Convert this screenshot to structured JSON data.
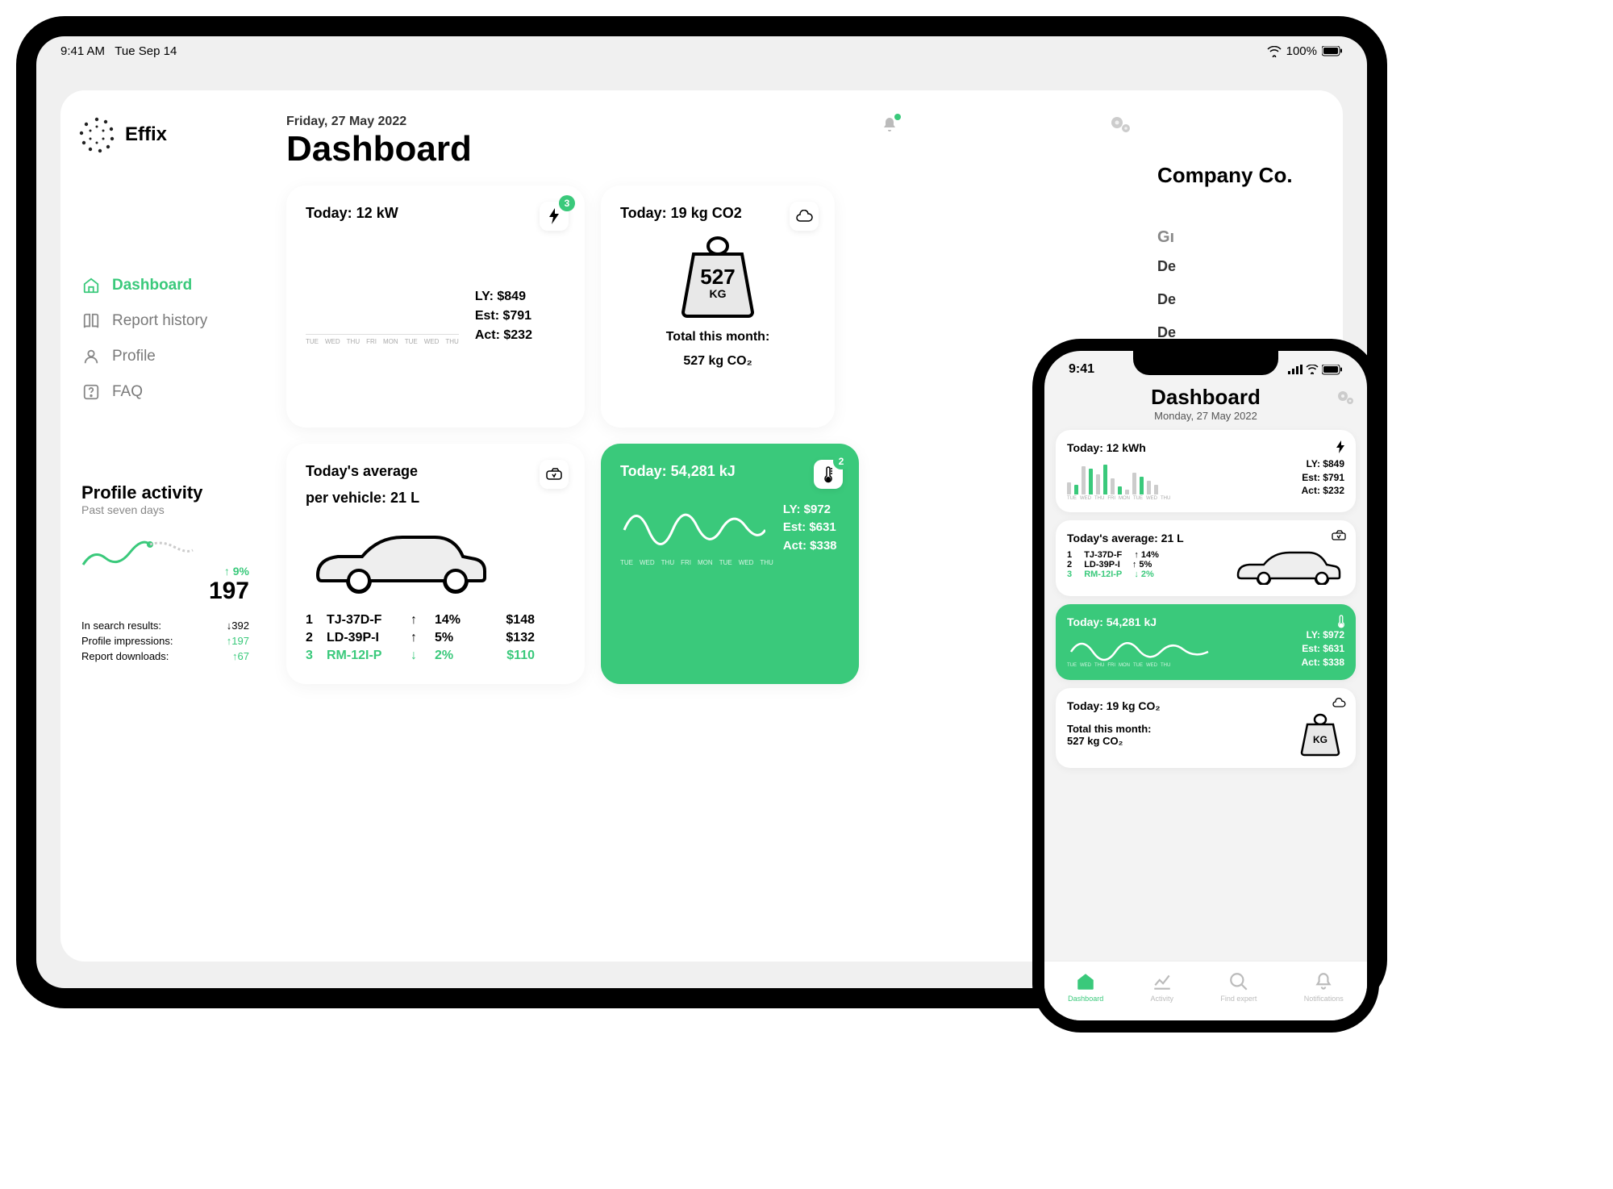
{
  "ipad_status": {
    "time": "9:41 AM",
    "date": "Tue Sep 14",
    "battery": "100%"
  },
  "iphone_status": {
    "time": "9:41"
  },
  "logo": {
    "text": "Effix"
  },
  "nav": {
    "dashboard": "Dashboard",
    "report_history": "Report history",
    "profile": "Profile",
    "faq": "FAQ"
  },
  "profile_activity": {
    "title": "Profile activity",
    "subtitle": "Past seven days",
    "delta": "↑ 9%",
    "value": "197",
    "rows": [
      {
        "label": "In search results:",
        "dir": "neg",
        "val": "392"
      },
      {
        "label": "Profile impressions:",
        "dir": "pos",
        "val": "197"
      },
      {
        "label": "Report downloads:",
        "dir": "pos",
        "val": "67"
      }
    ]
  },
  "header": {
    "date": "Friday, 27 May 2022",
    "title": "Dashboard"
  },
  "company": "Company Co.",
  "right": {
    "group": "Gı",
    "items": [
      "De",
      "De",
      "De"
    ]
  },
  "kw_card": {
    "title": "Today: 12 kW",
    "badge": "3",
    "ly": "LY: $849",
    "est": "Est: $791",
    "act": "Act: $232",
    "labels": [
      "TUE",
      "WED",
      "THU",
      "FRI",
      "MON",
      "TUE",
      "WED",
      "THU"
    ]
  },
  "co2_card": {
    "title": "Today: 19 kg CO2",
    "big": "527",
    "unit": "KG",
    "total1": "Total this month:",
    "total2": "527 kg CO₂"
  },
  "vehicle_card": {
    "title1": "Today's average",
    "title2": "per vehicle: 21 L",
    "rows": [
      {
        "idx": "1",
        "code": "TJ-37D-F",
        "arrow": "↑",
        "pct": "14%",
        "price": "$148"
      },
      {
        "idx": "2",
        "code": "LD-39P-I",
        "arrow": "↑",
        "pct": "5%",
        "price": "$132"
      },
      {
        "idx": "3",
        "code": "RM-12I-P",
        "arrow": "↓",
        "pct": "2%",
        "price": "$110"
      }
    ]
  },
  "kj_card": {
    "title": "Today: 54,281 kJ",
    "badge": "2",
    "ly": "LY: $972",
    "est": "Est: $631",
    "act": "Act: $338",
    "labels": [
      "TUE",
      "WED",
      "THU",
      "FRI",
      "MON",
      "TUE",
      "WED",
      "THU"
    ]
  },
  "mobile": {
    "title": "Dashboard",
    "date": "Monday, 27 May 2022",
    "kw_title": "Today: 12 kWh",
    "avg_title": "Today's average: 21 L",
    "kj_title": "Today: 54,281 kJ",
    "co2_title": "Today: 19 kg CO₂",
    "co2_total1": "Total this month:",
    "co2_total2": "527 kg CO₂",
    "co2_unit": "KG",
    "vrows": [
      {
        "idx": "1",
        "code": "TJ-37D-F",
        "delta": "↑ 14%"
      },
      {
        "idx": "2",
        "code": "LD-39P-I",
        "delta": "↑ 5%"
      },
      {
        "idx": "3",
        "code": "RM-12I-P",
        "delta": "↓ 2%"
      }
    ],
    "tabs": {
      "dashboard": "Dashboard",
      "activity": "Activity",
      "find": "Find expert",
      "notif": "Notifications"
    }
  },
  "chart_data": {
    "kw_bars": {
      "type": "bar",
      "categories": [
        "TUE",
        "WED",
        "THU",
        "FRI",
        "MON",
        "TUE",
        "WED",
        "THU"
      ],
      "series": [
        {
          "name": "grey",
          "values": [
            30,
            75,
            50,
            40,
            10,
            55,
            35,
            25
          ]
        },
        {
          "name": "green",
          "values": [
            25,
            70,
            80,
            20,
            0,
            45,
            0,
            0
          ]
        }
      ],
      "ylim": [
        0,
        100
      ]
    },
    "kj_wave": {
      "type": "line",
      "categories": [
        "TUE",
        "WED",
        "THU",
        "FRI",
        "MON",
        "TUE",
        "WED",
        "THU"
      ],
      "values": [
        40,
        70,
        30,
        75,
        35,
        80,
        30,
        70
      ]
    },
    "profile_spark": {
      "type": "line",
      "values": [
        20,
        35,
        30,
        45,
        55,
        50,
        65
      ]
    }
  }
}
